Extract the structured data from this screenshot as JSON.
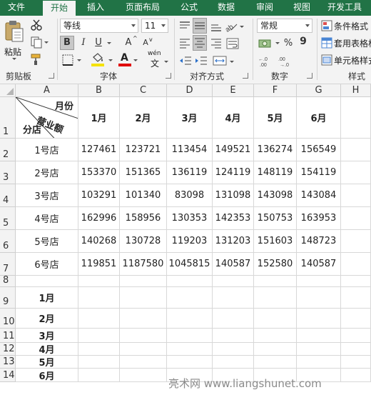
{
  "tabs": [
    "文件",
    "开始",
    "插入",
    "页面布局",
    "公式",
    "数据",
    "审阅",
    "视图",
    "开发工具"
  ],
  "active_tab": "开始",
  "ribbon": {
    "clipboard": {
      "label": "剪贴板",
      "paste_label": "粘贴"
    },
    "font": {
      "label": "字体",
      "font_name": "等线",
      "font_size": "11",
      "bold": "B",
      "italic": "I",
      "underline": "U",
      "grow_font": "A",
      "shrink_font": "A",
      "font_color_letter": "A",
      "wen": "wén",
      "wen_char": "文",
      "fill_color": "#f5e200",
      "font_color": "#e00000"
    },
    "alignment": {
      "label": "对齐方式"
    },
    "number": {
      "label": "数字",
      "format": "常规",
      "percent": "%",
      "comma": "9"
    },
    "styles": {
      "label": "样式",
      "items": [
        "条件格式",
        "套用表格格",
        "单元格样式"
      ]
    }
  },
  "sheet": {
    "columns": [
      "A",
      "B",
      "C",
      "D",
      "E",
      "F",
      "G",
      "H"
    ],
    "rows": [
      "1",
      "2",
      "3",
      "4",
      "5",
      "6",
      "7",
      "8",
      "9",
      "10",
      "11",
      "12",
      "13",
      "14"
    ],
    "header_cell": {
      "top_right": "月份",
      "middle": "营业额",
      "bottom_left": "分店"
    },
    "month_headers": [
      "1月",
      "2月",
      "3月",
      "4月",
      "5月",
      "6月"
    ],
    "data_rows": [
      {
        "store": "1号店",
        "values": [
          "127461",
          "123721",
          "113454",
          "149521",
          "136274",
          "156549"
        ]
      },
      {
        "store": "2号店",
        "values": [
          "153370",
          "151365",
          "136119",
          "124119",
          "148119",
          "154119"
        ]
      },
      {
        "store": "3号店",
        "values": [
          "103291",
          "101340",
          "83098",
          "131098",
          "143098",
          "143084"
        ]
      },
      {
        "store": "4号店",
        "values": [
          "162996",
          "158956",
          "130353",
          "142353",
          "150753",
          "163953"
        ]
      },
      {
        "store": "5号店",
        "values": [
          "140268",
          "130728",
          "119203",
          "131203",
          "151603",
          "148723"
        ]
      },
      {
        "store": "6号店",
        "values": [
          "119851",
          "1187580",
          "1045815",
          "140587",
          "152580",
          "140587"
        ]
      }
    ],
    "month_list": [
      "1月",
      "2月",
      "3月",
      "4月",
      "5月",
      "6月"
    ]
  },
  "watermark": "亮术网 www.liangshunet.com"
}
